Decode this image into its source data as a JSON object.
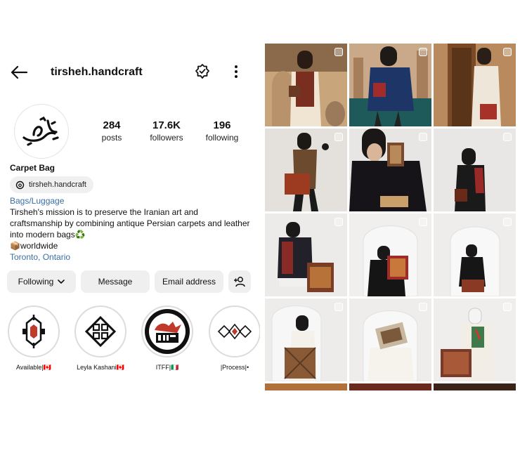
{
  "header": {
    "username": "tirsheh.handcraft"
  },
  "icons": {
    "back": "arrow-left-icon",
    "notifications": "bell-check-icon",
    "more": "vertical-ellipsis-icon",
    "threads": "threads-icon",
    "follow_dropdown": "chevron-down-icon",
    "add_user": "add-user-icon"
  },
  "stats": {
    "posts": {
      "value": "284",
      "label": "posts"
    },
    "followers": {
      "value": "17.6K",
      "label": "followers"
    },
    "following": {
      "value": "196",
      "label": "following"
    }
  },
  "profile": {
    "name": "Carpet Bag",
    "threads_handle": "tirsheh.handcraft",
    "category": "Bags/Luggage",
    "bio_line1": "Tirsheh's mission is to preserve the Iranian art and",
    "bio_line2": "craftsmanship by combining antique Persian carpets and leather",
    "bio_line3": "into modern bags♻️",
    "bio_line4": "📦worldwide",
    "location": "Toronto, Ontario"
  },
  "buttons": {
    "following": "Following",
    "message": "Message",
    "email": "Email address"
  },
  "highlights": [
    {
      "label": "Available|🇨🇦"
    },
    {
      "label": "Leyla Kashani🇨🇦"
    },
    {
      "label": "ITFF|🇮🇹"
    },
    {
      "label": "|Process|•"
    }
  ],
  "colors": {
    "link": "#3a6ea5",
    "button_bg": "#efefef"
  }
}
